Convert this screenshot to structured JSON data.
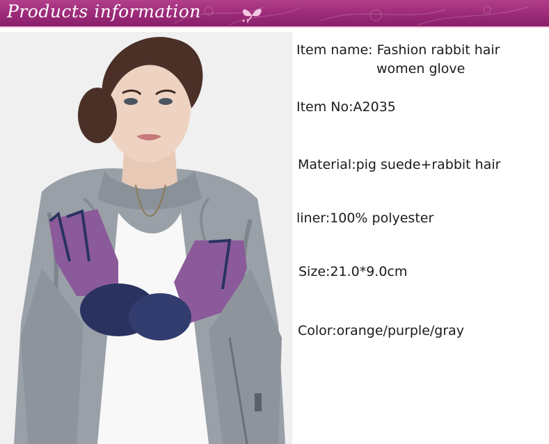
{
  "banner": {
    "title": "Products information"
  },
  "product": {
    "name_line1": "Item name: Fashion rabbit hair",
    "name_line2": "women glove",
    "item_no": "Item No:A2035",
    "material": "Material:pig suede+rabbit hair",
    "liner": "liner:100% polyester",
    "size": "Size:21.0*9.0cm",
    "color": "Color:orange/purple/gray"
  },
  "colors": {
    "banner": "#9b2a78",
    "glove_suede": "#8b5a9a",
    "glove_fur": "#2a3360",
    "jacket": "#9aa0a8"
  }
}
